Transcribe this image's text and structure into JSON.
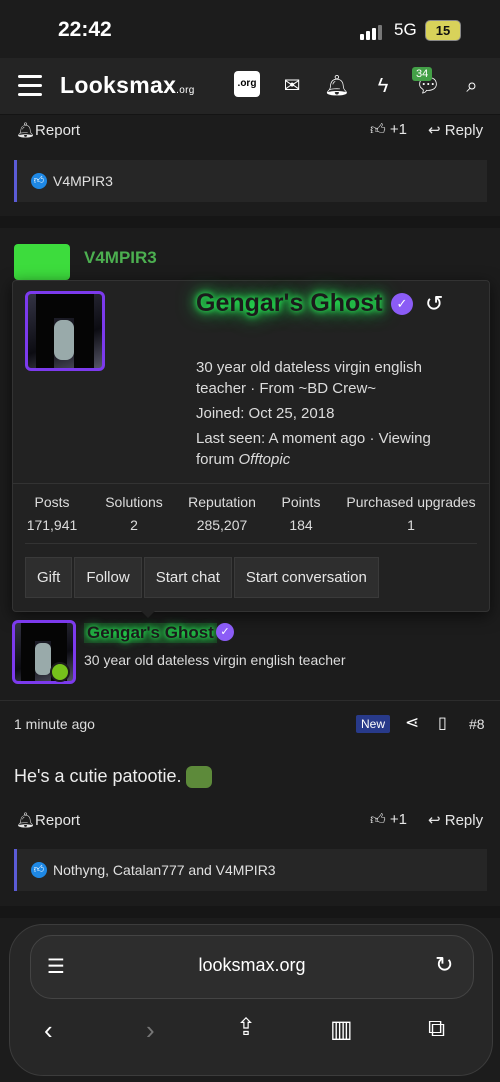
{
  "status_bar": {
    "time": "22:42",
    "network": "5G",
    "battery": "15"
  },
  "navbar": {
    "logo": "Looksmax",
    "logo_suffix": ".org",
    "org_badge": ".org",
    "chat_count": "34"
  },
  "prev_post": {
    "report": "Report",
    "like_count": "+1",
    "reply": "Reply",
    "reactions": "V4MPIR3"
  },
  "next_user": {
    "name": "V4MPIR3"
  },
  "popover": {
    "name": "Gengar's Ghost",
    "bio_line1": "30 year old dateless virgin english",
    "bio_line2": "teacher · From ~BD Crew~",
    "joined": "Joined: Oct 25, 2018",
    "last_seen_line1": "Last seen: A moment ago · Viewing",
    "last_seen_line2_prefix": "forum ",
    "last_seen_forum": "Offtopic",
    "stats": [
      {
        "label": "Posts",
        "value": "171,941"
      },
      {
        "label": "Solutions",
        "value": "2"
      },
      {
        "label": "Reputation",
        "value": "285,207"
      },
      {
        "label": "Points",
        "value": "184"
      },
      {
        "label": "Purchased upgrades",
        "value": "1"
      }
    ],
    "buttons": {
      "gift": "Gift",
      "follow": "Follow",
      "start_chat": "Start chat",
      "start_conversation": "Start conversation"
    }
  },
  "post": {
    "author": "Gengar's Ghost",
    "user_title": "30 year old dateless virgin english teacher",
    "time": "1 minute ago",
    "new_badge": "New",
    "post_number": "#8",
    "body": "He's a cutie patootie.",
    "report": "Report",
    "like_count": "+1",
    "reply": "Reply",
    "reactions": "Nothyng, Catalan777 and V4MPIR3"
  },
  "safari": {
    "url": "looksmax.org"
  }
}
